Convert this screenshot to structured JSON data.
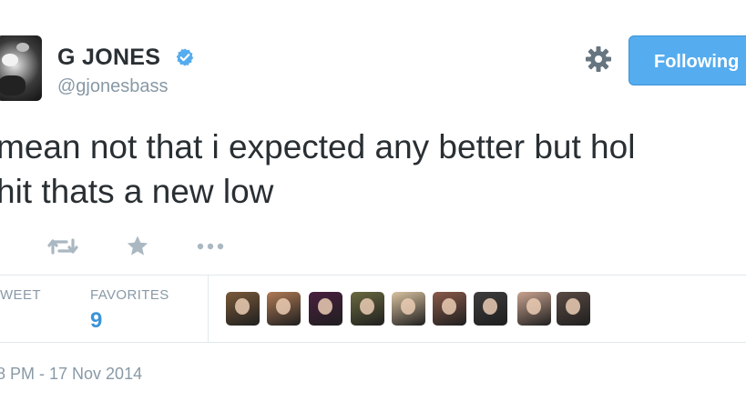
{
  "user": {
    "name": "G JONES",
    "handle": "@gjonesbass",
    "avatar_icon": "profile-photo",
    "verified_icon": "verified-badge-icon"
  },
  "header": {
    "settings_icon": "gear-icon",
    "follow_button_label": "Following"
  },
  "tweet": {
    "lines": [
      "mean not that i expected any better but hol",
      "hit thats a new low"
    ]
  },
  "actions": {
    "retweet_icon": "retweet-icon",
    "favorite_icon": "star-icon",
    "more_icon": "more-icon"
  },
  "stats": {
    "retweets_label": "WEET",
    "favorites_label": "FAVORITES",
    "favorites_count": "9"
  },
  "favoriters": {
    "count_shown": 9,
    "colors": [
      "#7a5a3a",
      "#b07a55",
      "#4a1f3f",
      "#6b6a40",
      "#d9c2a0",
      "#8a5a4a",
      "#3d3d3d",
      "#c9a38f",
      "#5a4a44"
    ]
  },
  "timestamp": "8 PM - 17 Nov 2014",
  "colors": {
    "accent": "#55acee",
    "link": "#3b94d9",
    "muted": "#8899a6",
    "text": "#292f33"
  }
}
